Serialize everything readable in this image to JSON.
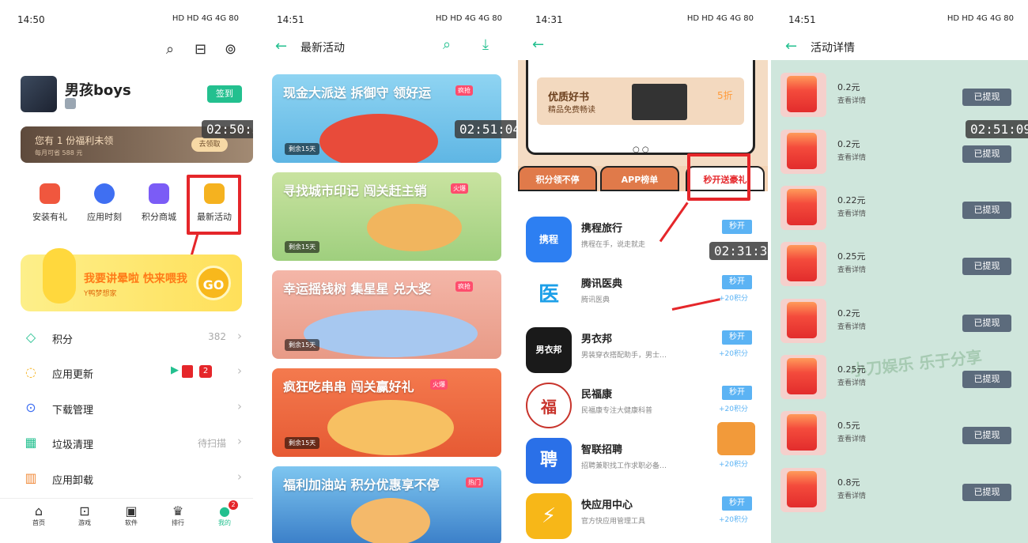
{
  "panel1": {
    "time": "14:50",
    "status_icons": "HD HD 4G 4G 80",
    "username": "男孩boys",
    "signin_label": "签到",
    "welfare_text": "您有 1 份福利未领",
    "welfare_sub": "每月可省 588 元",
    "welfare_button": "去领取",
    "timer": "02:50:57",
    "quick_actions": [
      {
        "label": "安装有礼",
        "color": "#f0573e"
      },
      {
        "label": "应用时刻",
        "color": "#3f6ff2"
      },
      {
        "label": "积分商城",
        "color": "#7b5cf6"
      },
      {
        "label": "最新活动",
        "color": "#f5b21f"
      }
    ],
    "duck_banner": {
      "text": "我要讲晕啦 快来喂我",
      "sub": "Y鸭梦想家",
      "go": "GO"
    },
    "menu": [
      {
        "label": "积分",
        "value": "382",
        "icon": "◇",
        "icon_name": "diamond-icon"
      },
      {
        "label": "应用更新",
        "value": "2",
        "icon": "◌",
        "icon_name": "update-icon"
      },
      {
        "label": "下载管理",
        "value": "",
        "icon": "⊙",
        "icon_name": "download-icon"
      },
      {
        "label": "垃圾清理",
        "value": "待扫描",
        "icon": "▦",
        "icon_name": "cleanup-icon"
      },
      {
        "label": "应用卸载",
        "value": "",
        "icon": "▥",
        "icon_name": "uninstall-icon"
      }
    ],
    "tabs": [
      {
        "label": "首页",
        "icon": "⌂"
      },
      {
        "label": "游戏",
        "icon": "⊡"
      },
      {
        "label": "软件",
        "icon": "▣"
      },
      {
        "label": "排行",
        "icon": "♛"
      },
      {
        "label": "我的",
        "icon": "●"
      }
    ],
    "tab_badge": "2"
  },
  "panel2": {
    "time": "14:51",
    "title": "最新活动",
    "timer": "02:51:04",
    "cards": [
      {
        "title": "现金大派送 拆御守 领好运",
        "badge": "疯抢",
        "remaining": "剩余15天",
        "bg1": "#8fd4f2",
        "bg2": "#e84b3a"
      },
      {
        "title": "寻找城市印记 闯关赶主销",
        "badge": "火爆",
        "remaining": "剩余15天",
        "bg1": "#c9e3a0",
        "bg2": "#f1b55e"
      },
      {
        "title": "幸运摇钱树 集星星 兑大奖",
        "badge": "疯抢",
        "remaining": "剩余15天",
        "bg1": "#f4b6a8",
        "bg2": "#a7c8f0"
      },
      {
        "title": "疯狂吃串串 闯关赢好礼",
        "badge": "火爆",
        "remaining": "剩余15天",
        "bg1": "#f47a4e",
        "bg2": "#f7c062"
      },
      {
        "title": "福利加油站 积分优惠享不停",
        "badge": "热门",
        "remaining": "",
        "bg1": "#7ec6f0",
        "bg2": "#3a7ec8"
      }
    ]
  },
  "panel3": {
    "time": "14:31",
    "book_title": "优质好书",
    "book_sub": "精品免费畅读",
    "book_discount": "5折",
    "tabs": [
      "积分领不停",
      "APP榜单",
      "秒开送豪礼"
    ],
    "timer": "02:31:33",
    "apps": [
      {
        "name": "携程旅行",
        "desc": "携程在手，说走就走",
        "btn": "秒开",
        "points": "",
        "color": "#2d7ff2",
        "glyph": "携程"
      },
      {
        "name": "腾讯医典",
        "desc": "腾讯医典",
        "btn": "秒开",
        "points": "+20积分",
        "color": "#1c9fe8",
        "glyph": "医"
      },
      {
        "name": "男衣邦",
        "desc": "男装穿衣搭配助手，男士…",
        "btn": "秒开",
        "points": "+20积分",
        "color": "#1a1a1a",
        "glyph": "男衣邦"
      },
      {
        "name": "民福康",
        "desc": "民福康专注大健康科普",
        "btn": "秒开",
        "points": "+20积分",
        "color": "#c8342c",
        "glyph": "福"
      },
      {
        "name": "智联招聘",
        "desc": "招聘兼职找工作求职必备…",
        "btn": "秒开",
        "points": "+20积分",
        "color": "#2a70e8",
        "glyph": "聘"
      },
      {
        "name": "快应用中心",
        "desc": "官方快应用管理工具",
        "btn": "秒开",
        "points": "+20积分",
        "color": "#f7b718",
        "glyph": "⚡"
      }
    ]
  },
  "panel4": {
    "time": "14:51",
    "title": "活动详情",
    "timer": "02:51:09",
    "watermark": "小刀娱乐 乐于分享",
    "items": [
      {
        "amount": "0.2元",
        "detail": "查看详情",
        "btn": "已提现"
      },
      {
        "amount": "0.2元",
        "detail": "查看详情",
        "btn": "已提现"
      },
      {
        "amount": "0.22元",
        "detail": "查看详情",
        "btn": "已提现"
      },
      {
        "amount": "0.25元",
        "detail": "查看详情",
        "btn": "已提现"
      },
      {
        "amount": "0.2元",
        "detail": "查看详情",
        "btn": "已提现"
      },
      {
        "amount": "0.25元",
        "detail": "查看详情",
        "btn": "已提现"
      },
      {
        "amount": "0.5元",
        "detail": "查看详情",
        "btn": "已提现"
      },
      {
        "amount": "0.8元",
        "detail": "查看详情",
        "btn": "已提现"
      }
    ]
  },
  "colors": {
    "accent": "#23c08f",
    "highlight": "#e5262a",
    "button_blue": "#5bb3f4",
    "withdraw_btn": "#5c6b7c"
  }
}
